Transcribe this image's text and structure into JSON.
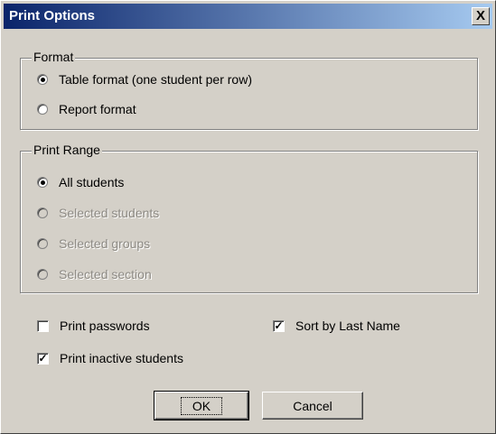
{
  "window": {
    "title": "Print Options",
    "close_glyph": "X"
  },
  "format": {
    "label": "Format",
    "options": [
      {
        "label": "Table format (one student per row)",
        "selected": true,
        "enabled": true
      },
      {
        "label": "Report format",
        "selected": false,
        "enabled": true
      }
    ]
  },
  "print_range": {
    "label": "Print Range",
    "options": [
      {
        "label": "All students",
        "selected": true,
        "enabled": true
      },
      {
        "label": "Selected students",
        "selected": false,
        "enabled": false
      },
      {
        "label": "Selected groups",
        "selected": false,
        "enabled": false
      },
      {
        "label": "Selected section",
        "selected": false,
        "enabled": false
      }
    ]
  },
  "checkboxes": {
    "print_passwords": {
      "label": "Print passwords",
      "checked": false
    },
    "sort_by_last_name": {
      "label": "Sort by Last Name",
      "checked": true
    },
    "print_inactive": {
      "label": "Print inactive students",
      "checked": true
    }
  },
  "buttons": {
    "ok": "OK",
    "cancel": "Cancel"
  },
  "colors": {
    "face": "#d4d0c8",
    "title_start": "#0a246a",
    "title_end": "#a6caf0",
    "disabled_text": "#8d8a84"
  }
}
